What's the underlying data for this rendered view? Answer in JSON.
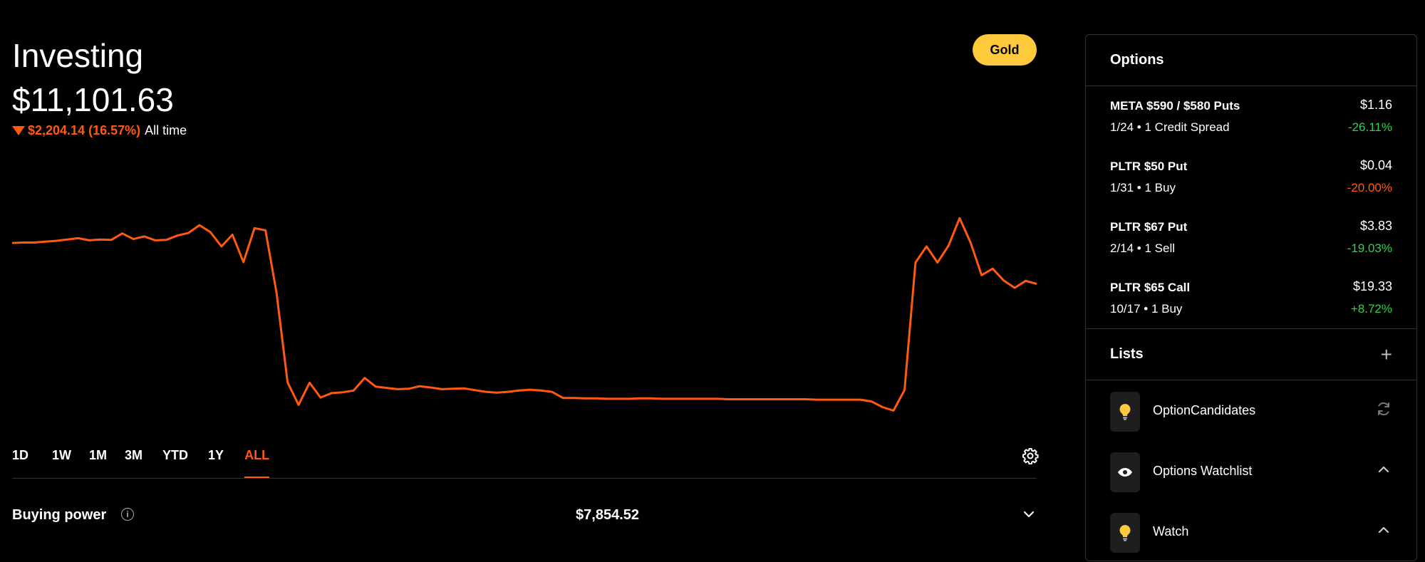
{
  "colors": {
    "accent": "#ff5a0f",
    "gain": "#2fd24e",
    "loss": "#ff5a0f",
    "gold": "#ffc93c"
  },
  "header": {
    "title": "Investing",
    "balance": "$11,101.63",
    "change": "$2,204.14 (16.57%)",
    "change_period": "All time",
    "gold_label": "Gold"
  },
  "chart_data": {
    "type": "line",
    "title": "",
    "xlabel": "",
    "ylabel": "",
    "values": [
      100,
      100.1,
      100.1,
      100.3,
      100.5,
      100.8,
      101.1,
      100.6,
      100.8,
      100.7,
      102.2,
      100.9,
      101.5,
      100.6,
      100.7,
      101.7,
      102.3,
      104.1,
      102.5,
      99.2,
      101.9,
      95.6,
      103.4,
      102.9,
      88.6,
      68,
      62.8,
      67.9,
      64.5,
      65.5,
      65.7,
      66.1,
      69,
      67,
      66.7,
      66.4,
      66.5,
      67.1,
      66.8,
      66.4,
      66.5,
      66.6,
      66.2,
      65.8,
      65.6,
      65.8,
      66.1,
      66.3,
      66.1,
      65.8,
      64.4,
      64.4,
      64.3,
      64.3,
      64.2,
      64.2,
      64.2,
      64.3,
      64.3,
      64.2,
      64.2,
      64.2,
      64.2,
      64.2,
      64.2,
      64.1,
      64.1,
      64.1,
      64.1,
      64.1,
      64.1,
      64.1,
      64.1,
      64.0,
      64.0,
      64.0,
      64.0,
      64.0,
      63.6,
      62.3,
      61.5,
      66.2,
      95.5,
      99.2,
      95.5,
      99.4,
      105.7,
      100.1,
      92.6,
      94.1,
      91.4,
      89.7,
      91.3,
      90.6
    ],
    "ylim": [
      56,
      110
    ],
    "line_color": "#ff5a0f",
    "grid": false
  },
  "ranges": [
    "1D",
    "1W",
    "1M",
    "3M",
    "YTD",
    "1Y",
    "ALL"
  ],
  "active_range": "ALL",
  "buying_power": {
    "label": "Buying power",
    "value": "$7,854.52"
  },
  "options": {
    "title": "Options",
    "items": [
      {
        "name": "META $590 / $580 Puts",
        "sub": "1/24 • 1 Credit Spread",
        "price": "$1.16",
        "change": "-26.11%",
        "change_color": "#2fd24e"
      },
      {
        "name": "PLTR $50 Put",
        "sub": "1/31 • 1 Buy",
        "price": "$0.04",
        "change": "-20.00%",
        "change_color": "#ff5a0f"
      },
      {
        "name": "PLTR $67 Put",
        "sub": "2/14 • 1 Sell",
        "price": "$3.83",
        "change": "-19.03%",
        "change_color": "#2fd24e"
      },
      {
        "name": "PLTR $65 Call",
        "sub": "10/17 • 1 Buy",
        "price": "$19.33",
        "change": "+8.72%",
        "change_color": "#2fd24e"
      }
    ]
  },
  "lists": {
    "title": "Lists",
    "add_icon": "plus-icon",
    "items": [
      {
        "label": "OptionCandidates",
        "icon": "lightbulb-icon",
        "action": "refresh-icon"
      },
      {
        "label": "Options Watchlist",
        "icon": "eye-icon",
        "action": "chevron-up-icon"
      },
      {
        "label": "Watch",
        "icon": "lightbulb-icon",
        "action": "chevron-up-icon"
      }
    ]
  }
}
